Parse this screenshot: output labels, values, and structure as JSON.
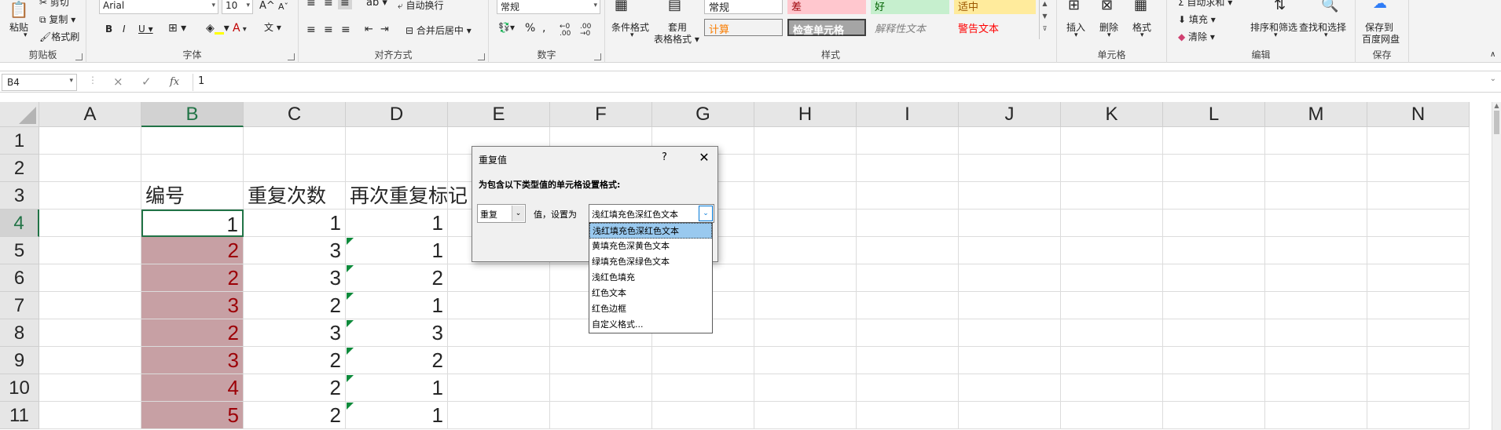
{
  "ribbon": {
    "clipboard": {
      "paste": "粘贴",
      "cut": "剪切",
      "copy": "复制",
      "format_painter": "格式刷",
      "label": "剪贴板"
    },
    "font": {
      "font_name": "Arial",
      "font_size": "10",
      "bold": "B",
      "italic": "I",
      "underline": "U",
      "grow": "A",
      "shrink": "A",
      "font_color": "A",
      "label": "字体"
    },
    "alignment": {
      "wrap": "自动换行",
      "merge": "合并后居中",
      "label": "对齐方式"
    },
    "number": {
      "format": "常规",
      "percent": "%",
      "comma": ",",
      "label": "数字"
    },
    "styles": {
      "conditional": "条件格式",
      "table1": "套用",
      "table2": "表格格式",
      "normal": "常规",
      "bad": "差",
      "good": "好",
      "neutral": "适中",
      "calc": "计算",
      "check": "检查单元格",
      "explanatory": "解释性文本",
      "warning": "警告文本",
      "label": "样式"
    },
    "cells": {
      "insert": "插入",
      "delete": "删除",
      "format": "格式",
      "label": "单元格"
    },
    "editing": {
      "autosum": "自动求和",
      "fill": "填充",
      "clear": "清除",
      "sort": "排序和筛选",
      "find": "查找和选择",
      "label": "编辑"
    },
    "save": {
      "line1": "保存到",
      "line2": "百度网盘",
      "label": "保存"
    }
  },
  "formula_bar": {
    "name_box": "B4",
    "cancel": "×",
    "enter": "✓",
    "fx": "fx",
    "value": "1"
  },
  "columns": [
    "A",
    "B",
    "C",
    "D",
    "E",
    "F",
    "G",
    "H",
    "I",
    "J",
    "K",
    "L",
    "M",
    "N"
  ],
  "rows": [
    "1",
    "2",
    "3",
    "4",
    "5",
    "6",
    "7",
    "8",
    "9",
    "10",
    "11"
  ],
  "table": {
    "headers": [
      "编号",
      "重复次数",
      "再次重复标记"
    ],
    "rows": [
      {
        "b": "1",
        "c": "1",
        "d": "1"
      },
      {
        "b": "2",
        "c": "3",
        "d": "1"
      },
      {
        "b": "2",
        "c": "3",
        "d": "2"
      },
      {
        "b": "3",
        "c": "2",
        "d": "1"
      },
      {
        "b": "2",
        "c": "3",
        "d": "3"
      },
      {
        "b": "3",
        "c": "2",
        "d": "2"
      },
      {
        "b": "4",
        "c": "2",
        "d": "1"
      },
      {
        "b": "5",
        "c": "2",
        "d": "1"
      }
    ]
  },
  "dialog": {
    "title": "重复值",
    "help": "?",
    "close": "✕",
    "prompt": "为包含以下类型值的单元格设置格式:",
    "type_value": "重复",
    "middle_text": "值，设置为",
    "format_value": "浅红填充色深红色文本",
    "options": [
      "浅红填充色深红色文本",
      "黄填充色深黄色文本",
      "绿填充色深绿色文本",
      "浅红色填充",
      "红色文本",
      "红色边框",
      "自定义格式..."
    ]
  },
  "colors": {
    "accent": "#217346",
    "dup_fill": "#c7a0a4",
    "dup_text": "#9c0006",
    "bad": "#ffc7ce",
    "good": "#c6efce",
    "neutral": "#ffeb9c"
  }
}
